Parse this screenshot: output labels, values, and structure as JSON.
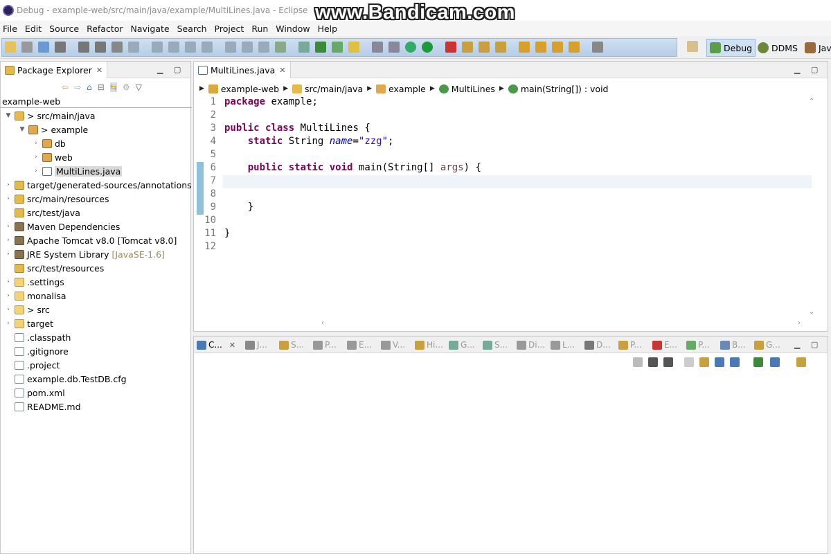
{
  "window": {
    "title": "Debug - example-web/src/main/java/example/MultiLines.java - Eclipse"
  },
  "watermark": "www.Bandicam.com",
  "menu": [
    "File",
    "Edit",
    "Source",
    "Refactor",
    "Navigate",
    "Search",
    "Project",
    "Run",
    "Window",
    "Help"
  ],
  "perspectives": [
    {
      "label": "Debug",
      "icon": "debug-perspective-icon",
      "active": true
    },
    {
      "label": "DDMS",
      "icon": "ddms-perspective-icon",
      "active": false
    },
    {
      "label": "Jav",
      "icon": "java-perspective-icon",
      "active": false
    }
  ],
  "package_explorer": {
    "tab_label": "Package Explorer",
    "project": "example-web",
    "items": [
      {
        "label": "> src/main/java",
        "indent": 0,
        "arrow": "▼",
        "icon": "pkgroot"
      },
      {
        "label": "> example",
        "indent": 1,
        "arrow": "▼",
        "icon": "pkg"
      },
      {
        "label": "db",
        "indent": 2,
        "arrow": "›",
        "icon": "pkg"
      },
      {
        "label": "web",
        "indent": 2,
        "arrow": "›",
        "icon": "pkg"
      },
      {
        "label": "MultiLines.java",
        "indent": 2,
        "arrow": "›",
        "icon": "java",
        "selected": true
      },
      {
        "label": "target/generated-sources/annotations",
        "indent": 0,
        "arrow": "›",
        "icon": "pkgroot"
      },
      {
        "label": "src/main/resources",
        "indent": 0,
        "arrow": "›",
        "icon": "pkgroot"
      },
      {
        "label": "src/test/java",
        "indent": 0,
        "arrow": "",
        "icon": "pkgroot"
      },
      {
        "label": "Maven Dependencies",
        "indent": 0,
        "arrow": "›",
        "icon": "lib"
      },
      {
        "label": "Apache Tomcat v8.0 [Tomcat v8.0]",
        "indent": 0,
        "arrow": "›",
        "icon": "lib"
      },
      {
        "label": "JRE System Library",
        "suffix": "[JavaSE-1.6]",
        "indent": 0,
        "arrow": "›",
        "icon": "lib"
      },
      {
        "label": "src/test/resources",
        "indent": 0,
        "arrow": "",
        "icon": "pkgroot"
      },
      {
        "label": ".settings",
        "indent": 0,
        "arrow": "›",
        "icon": "folder"
      },
      {
        "label": "monalisa",
        "indent": 0,
        "arrow": "›",
        "icon": "folder"
      },
      {
        "label": "> src",
        "indent": 0,
        "arrow": "›",
        "icon": "folder"
      },
      {
        "label": "target",
        "indent": 0,
        "arrow": "›",
        "icon": "folder"
      },
      {
        "label": ".classpath",
        "indent": 0,
        "arrow": "",
        "icon": "file"
      },
      {
        "label": ".gitignore",
        "indent": 0,
        "arrow": "",
        "icon": "file"
      },
      {
        "label": ".project",
        "indent": 0,
        "arrow": "",
        "icon": "file"
      },
      {
        "label": "example.db.TestDB.cfg",
        "indent": 0,
        "arrow": "",
        "icon": "file"
      },
      {
        "label": "pom.xml",
        "indent": 0,
        "arrow": "",
        "icon": "file"
      },
      {
        "label": "README.md",
        "indent": 0,
        "arrow": "",
        "icon": "file"
      }
    ]
  },
  "editor": {
    "tab_label": "MultiLines.java",
    "breadcrumb": [
      "example-web",
      "src/main/java",
      "example",
      "MultiLines",
      "main(String[]) : void"
    ],
    "line_numbers": [
      "1",
      "2",
      "3",
      "4",
      "5",
      "6",
      "7",
      "8",
      "9",
      "10",
      "11",
      "12"
    ],
    "lines": [
      "package example;",
      "",
      "public class MultiLines {",
      "    static String name=\"zzg\";",
      "",
      "    public static void main(String[] args) {",
      "",
      "",
      "    }",
      "",
      "}",
      ""
    ]
  },
  "bottom_panel": {
    "tabs": [
      "C...",
      "J...",
      "S...",
      "P...",
      "E...",
      "V...",
      "Hi...",
      "G...",
      "S...",
      "Di...",
      "L...",
      "D...",
      "P...",
      "E...",
      "P...",
      "B...",
      "G..."
    ]
  }
}
